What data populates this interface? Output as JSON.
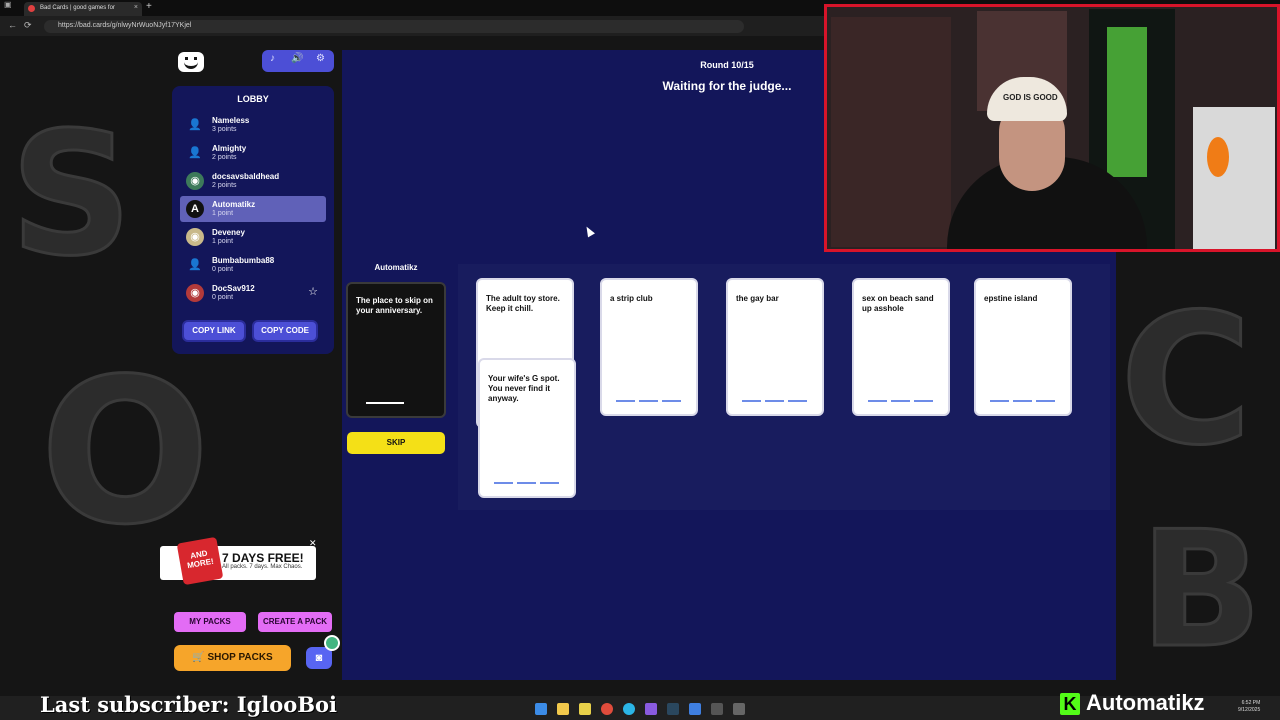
{
  "browser": {
    "tab_title": "Bad Cards | good games for",
    "url": "https://bad.cards/g/nlwyNrWuoNJyf17YKjel",
    "close_glyph": "×",
    "new_tab_glyph": "+",
    "back_glyph": "←",
    "reload_glyph": "⟳"
  },
  "controls": {
    "music_glyph": "♪",
    "volume_glyph": "🔊",
    "settings_glyph": "⚙"
  },
  "lobby": {
    "title": "LOBBY",
    "players": [
      {
        "name": "Nameless",
        "points": "3 points",
        "avatar": "👤"
      },
      {
        "name": "Almighty",
        "points": "2 points",
        "avatar": "👤"
      },
      {
        "name": "docsavsbaldhead",
        "points": "2 points",
        "avatar": "◉"
      },
      {
        "name": "Automatikz",
        "points": "1 point",
        "avatar": "A"
      },
      {
        "name": "Deveney",
        "points": "1 point",
        "avatar": "◉"
      },
      {
        "name": "Bumbabumba88",
        "points": "0 point",
        "avatar": "👤"
      },
      {
        "name": "DocSav912",
        "points": "0 point",
        "avatar": "◉"
      }
    ],
    "star_glyph": "☆",
    "copy_link": "COPY LINK",
    "copy_code": "COPY CODE"
  },
  "game": {
    "round": "Round 10/15",
    "status": "Waiting for the judge...",
    "judge": "Automatikz",
    "black_card": "The place to skip on your anniversary.",
    "skip_label": "SKIP",
    "white_cards": [
      "The adult toy store. Keep it chill.",
      "Your wife's G spot. You never find it anyway.",
      "a strip club",
      "the gay bar",
      "sex on beach sand up asshole",
      "epstine island"
    ]
  },
  "promo": {
    "tag": "AND MORE!",
    "title": "7 DAYS FREE!",
    "subtitle": "All packs. 7 days. Max Chaos.",
    "close_glyph": "✕"
  },
  "buttons": {
    "my_packs": "MY PACKS",
    "create_pack": "CREATE A PACK",
    "shop_packs": "🛒 SHOP PACKS",
    "discord_glyph": "◙"
  },
  "overlay": {
    "last_subscriber": "Last subscriber: IglooBoi",
    "brand_letter": "K",
    "brand_name": "Automatikz",
    "hat_text": "GOD IS GOOD",
    "clock_time": "6:52 PM",
    "clock_date": "9/12/2025"
  },
  "colors": {
    "panel": "#13165a",
    "accent": "#4c4fd6",
    "skip": "#f4e017",
    "pack_button": "#e36cf5",
    "shop": "#f6a52a",
    "webcam_border": "#d8142a",
    "kick_green": "#53fc18"
  }
}
